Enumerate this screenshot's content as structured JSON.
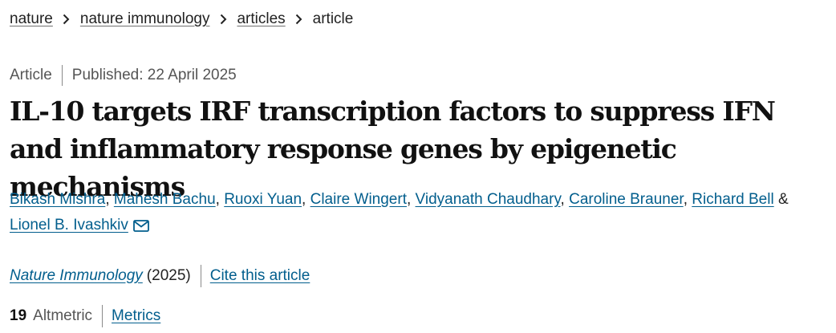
{
  "breadcrumb": {
    "items": [
      {
        "label": "nature"
      },
      {
        "label": "nature immunology"
      },
      {
        "label": "articles"
      }
    ],
    "current": "article"
  },
  "meta": {
    "type": "Article",
    "published": "Published: 22 April 2025"
  },
  "title": "IL-10 targets IRF transcription factors to suppress IFN and inflammatory response genes by epigenetic mechanisms",
  "authors": {
    "list": [
      "Bikash Mishra",
      "Mahesh Bachu",
      "Ruoxi Yuan",
      "Claire Wingert",
      "Vidyanath Chaudhary",
      "Caroline Brauner",
      "Richard Bell",
      "Lionel B. Ivashkiv"
    ],
    "separator": ", ",
    "conjunction": "&"
  },
  "citation": {
    "journal": "Nature Immunology",
    "year": "(2025)",
    "cite_label": "Cite this article"
  },
  "metrics": {
    "count": "19",
    "label": "Altmetric",
    "link_label": "Metrics"
  },
  "colors": {
    "link": "#025e8d",
    "text": "#222222",
    "muted": "#555555"
  },
  "icons": {
    "breadcrumb_separator": "chevron-right-icon",
    "corresponding_author": "mail-icon"
  }
}
